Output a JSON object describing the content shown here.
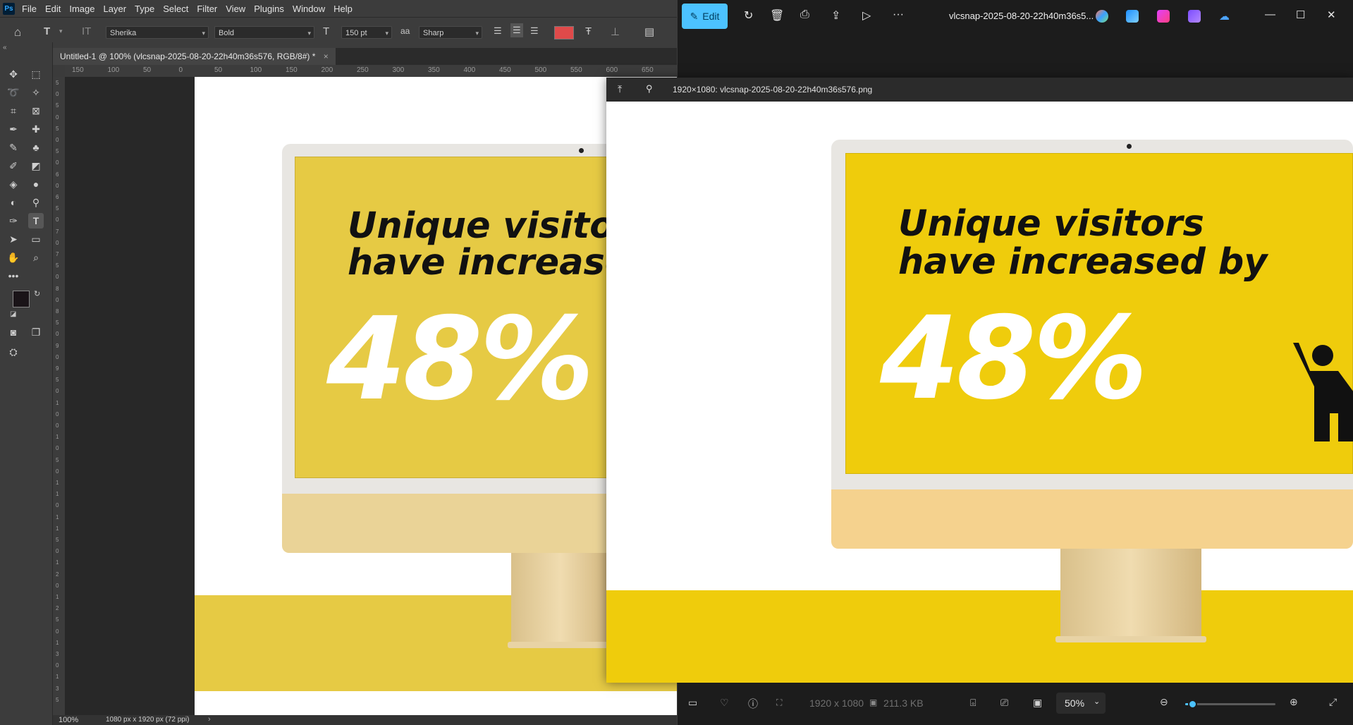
{
  "photoshop": {
    "menu": [
      "File",
      "Edit",
      "Image",
      "Layer",
      "Type",
      "Select",
      "Filter",
      "View",
      "Plugins",
      "Window",
      "Help"
    ],
    "options": {
      "font_family": "Sherika",
      "font_style": "Bold",
      "font_size": "150 pt",
      "antialias_icon": "aa",
      "antialias": "Sharp",
      "color": "#e04a4a"
    },
    "doc_tab": "Untitled-1 @ 100% (vlcsnap-2025-08-20-22h40m36s576, RGB/8#) *",
    "hruler": [
      "150",
      "100",
      "50",
      "0",
      "50",
      "100",
      "150",
      "200",
      "250",
      "300",
      "350",
      "400",
      "450",
      "500",
      "550",
      "600",
      "650"
    ],
    "vruler": [
      "5",
      "0",
      "5",
      "0",
      "5",
      "0",
      "5",
      "0",
      "6",
      "0",
      "6",
      "5",
      "0",
      "7",
      "0",
      "7",
      "5",
      "0",
      "8",
      "0",
      "8",
      "5",
      "0",
      "9",
      "0",
      "9",
      "5",
      "0",
      "1",
      "0",
      "0",
      "1",
      "0",
      "5",
      "0",
      "1",
      "1",
      "0",
      "1",
      "1",
      "5",
      "0",
      "1",
      "2",
      "0",
      "1",
      "2",
      "5",
      "0",
      "1",
      "3",
      "0",
      "1",
      "3",
      "5"
    ],
    "fg_color": "#1a1418",
    "bg_color": "#d63573",
    "status_zoom": "100%",
    "status_info": "1080 px x 1920 px (72 ppi)",
    "canvas_headline_1": "Unique visitors",
    "canvas_headline_2": "have increased by",
    "canvas_percent": "48%"
  },
  "viewer": {
    "edit_label": "Edit",
    "title": "vlcsnap-2025-08-20-22h40m36s5...",
    "float_title": "1920×1080: vlcsnap-2025-08-20-22h40m36s576.png",
    "headline_1": "Unique visitors",
    "headline_2": "have increased by",
    "percent": "48%",
    "dimensions": "1920 x 1080",
    "file_size": "211.3 KB",
    "zoom": "50%",
    "zoom_fraction": 0.05
  },
  "colors": {
    "yellow_ps": "#e6ca44",
    "yellow_viewer": "#efcc0c",
    "chin_ps": "#ead397",
    "chin_viewer": "#f5d28e",
    "accent": "#4cc2ff"
  }
}
